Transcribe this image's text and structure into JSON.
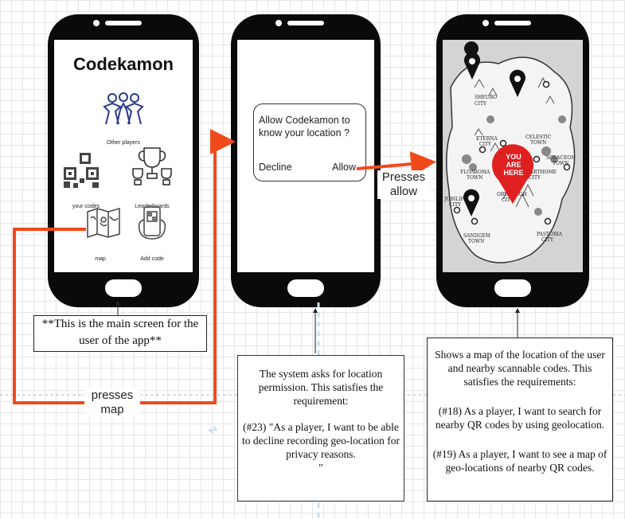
{
  "phone1": {
    "title": "Codekamon",
    "menu": [
      {
        "label": "Other players",
        "icon": "group-people-icon"
      },
      {
        "label": "your codes",
        "icon": "qr-code-icon"
      },
      {
        "label": "Leaderboards",
        "icon": "trophy-icon"
      },
      {
        "label": "map",
        "icon": "map-icon"
      },
      {
        "label": "Add code",
        "icon": "phone-scan-icon"
      }
    ]
  },
  "phone2": {
    "question": "Allow Codekamon to know your location ?",
    "decline": "Decline",
    "allow": "Allow"
  },
  "phone3": {
    "marker_text": "YOU ARE HERE",
    "towns": [
      "SHEURO CITY",
      "ETERNA CITY",
      "CELESTIC TOWN",
      "FLOAROMA TOWN",
      "HEARTHOME CITY",
      "SOLACEON TOWN",
      "JUBILIFE CITY",
      "OREBURGH CITY",
      "SANDGEM TOWN",
      "PASTORIA CITY"
    ]
  },
  "arrows": {
    "presses_allow": "Presses allow",
    "presses_map": "presses map"
  },
  "notes": {
    "main_screen": "**This is the main screen for the user of the app**",
    "location_permission": {
      "lines": [
        "The system asks for location permission. This satisfies the requirement:",
        "(#23) \"As a player, I want to be able to decline recording geo-location for privacy reasons.",
        "\""
      ]
    },
    "map_requirements": {
      "lines": [
        "Shows a map of the location of the user and nearby scannable codes. This satisfies the requirements:",
        "(#18) As a player, I want to search for nearby QR codes by using geolocation.",
        "(#19) As a player, I want to see a map of geo-locations of nearby QR codes."
      ]
    }
  },
  "colors": {
    "arrow": "#f04a1c",
    "marker": "#e02020",
    "phone": "#0a0a0a"
  }
}
